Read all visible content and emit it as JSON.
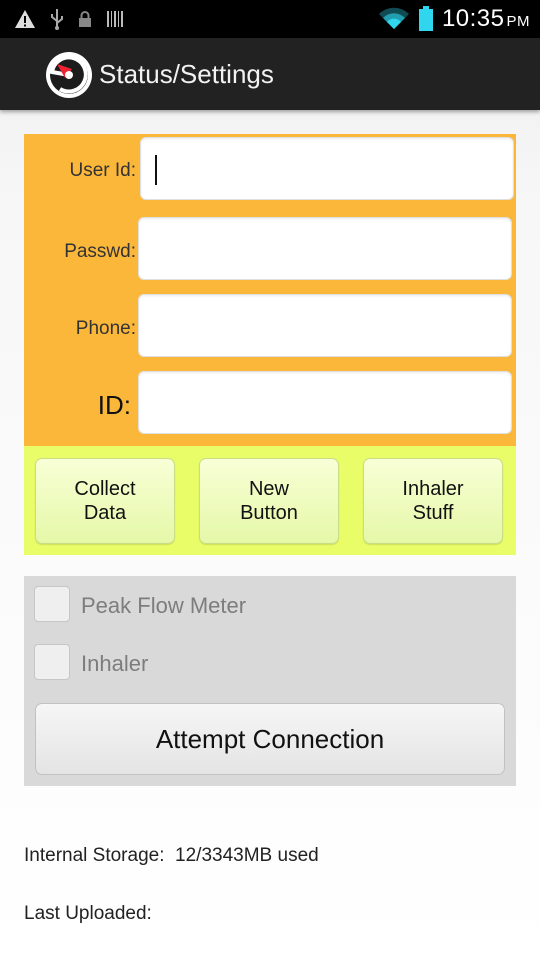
{
  "status_bar": {
    "time": "10:35",
    "ampm": "PM",
    "icons": [
      "warning-icon",
      "usb-icon",
      "lock-icon",
      "barcode-icon",
      "wifi-icon",
      "battery-icon"
    ]
  },
  "action_bar": {
    "title": "Status/Settings",
    "icon": "gauge-app-icon"
  },
  "login": {
    "user_id_label": "User Id:",
    "password_label": "Passwd:",
    "phone_label": "Phone:",
    "id_label": "ID:",
    "user_id_value": "",
    "password_value": "",
    "phone_value": "",
    "id_value": ""
  },
  "buttons": {
    "collect_data": "Collect\nData",
    "new_button": "New\nButton",
    "inhaler_stuff": "Inhaler\nStuff"
  },
  "devices": {
    "peak_flow_label": "Peak Flow Meter",
    "peak_flow_checked": false,
    "inhaler_label": "Inhaler",
    "inhaler_checked": false,
    "connect_label": "Attempt Connection"
  },
  "info": {
    "storage_label": "Internal Storage:",
    "storage_value": "12/3343MB used",
    "last_uploaded_label": "Last Uploaded:",
    "last_uploaded_value": ""
  },
  "colors": {
    "login_panel": "#fbb73a",
    "button_panel": "#e8fd68",
    "device_panel": "#d9d9d9",
    "action_bar": "#222222",
    "battery": "#2fd6ee",
    "wifi": "#2fd6ee"
  }
}
